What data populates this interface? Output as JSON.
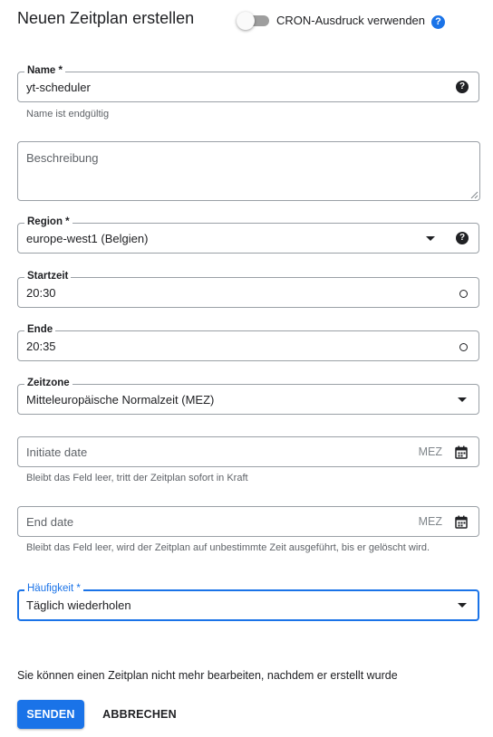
{
  "header": {
    "title": "Neuen Zeitplan erstellen",
    "cron_toggle_label": "CRON-Ausdruck verwenden",
    "help_glyph": "?"
  },
  "form": {
    "name": {
      "label": "Name *",
      "value": "yt-scheduler",
      "hint": "Name ist endgültig"
    },
    "description": {
      "placeholder": "Beschreibung"
    },
    "region": {
      "label": "Region *",
      "value": "europe-west1 (Belgien)"
    },
    "start_time": {
      "label": "Startzeit",
      "value": "20:30"
    },
    "end_time": {
      "label": "Ende",
      "value": "20:35"
    },
    "timezone": {
      "label": "Zeitzone",
      "value": "Mitteleuropäische Normalzeit (MEZ)"
    },
    "initiate_date": {
      "placeholder": "Initiate date",
      "suffix": "MEZ",
      "hint": "Bleibt das Feld leer, tritt der Zeitplan sofort in Kraft"
    },
    "end_date": {
      "placeholder": "End date",
      "suffix": "MEZ",
      "hint": "Bleibt das Feld leer, wird der Zeitplan auf unbestimmte Zeit ausgeführt, bis er gelöscht wird."
    },
    "frequency": {
      "label": "Häufigkeit *",
      "value": "Täglich wiederholen"
    }
  },
  "footer": {
    "note": "Sie können einen Zeitplan nicht mehr bearbeiten, nachdem er erstellt wurde",
    "send_label": "SENDEN",
    "cancel_label": "ABBRECHEN"
  },
  "colors": {
    "accent": "#1a73e8",
    "border": "#9aa0a6",
    "hint": "#5f6368"
  },
  "icons": [
    "help-icon",
    "dropdown-arrow-icon",
    "clock-icon",
    "calendar-icon",
    "resize-handle-icon"
  ]
}
